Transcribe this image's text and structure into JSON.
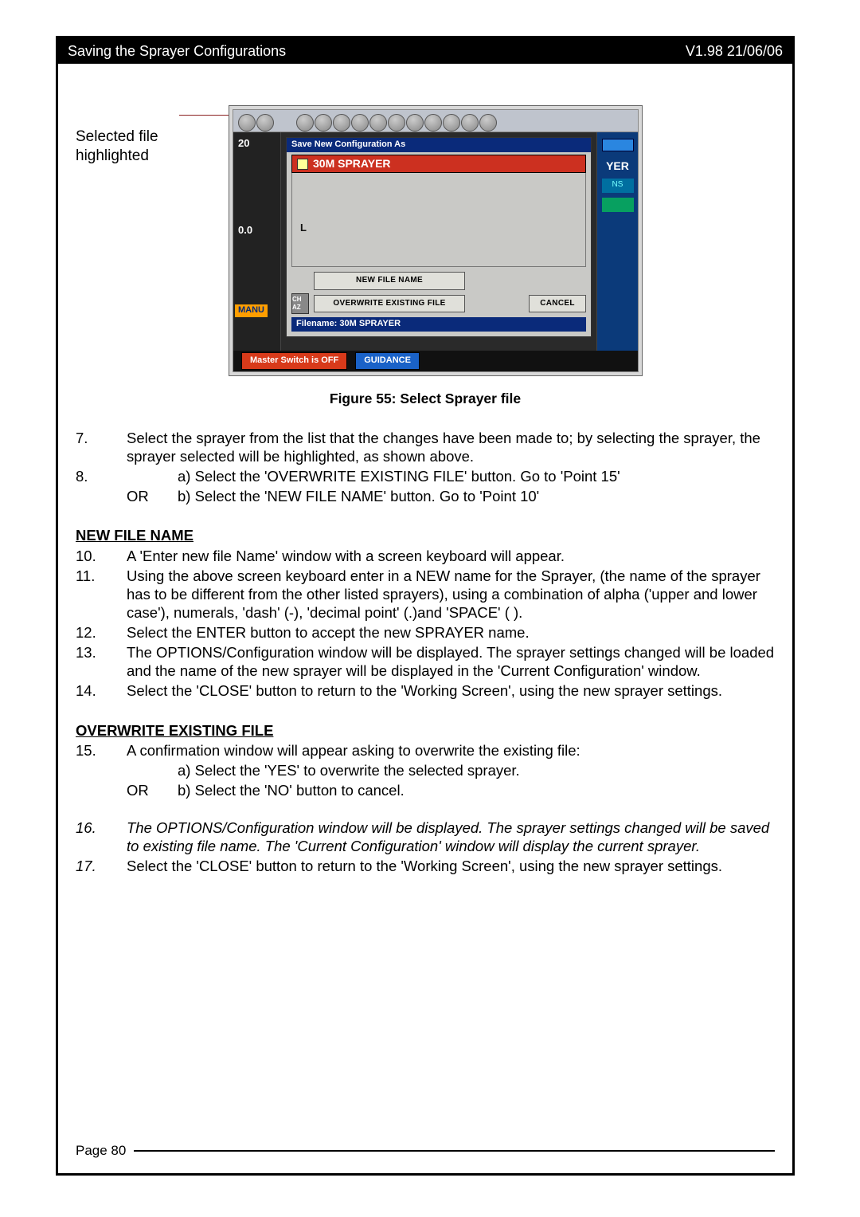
{
  "header": {
    "title": "Saving the Sprayer Configurations",
    "version": "V1.98 21/06/06"
  },
  "callout": {
    "line1": "Selected file",
    "line2": "highlighted"
  },
  "screenshot": {
    "dialog_title": "Save New Configuration As",
    "selected_file": "30M SPRAYER",
    "list_label_L": "L",
    "btn_new_file": "NEW FILE NAME",
    "btn_overwrite": "OVERWRITE EXISTING FILE",
    "btn_cancel": "CANCEL",
    "side_icon_label": "CH AZ",
    "filename_bar": "Filename: 30M SPRAYER",
    "footer_master": "Master Switch is OFF",
    "footer_guidance": "GUIDANCE",
    "footer_right": "",
    "left_val_top": "20",
    "left_val_bot": "0.0",
    "left_tag": "MANU",
    "right_text": "YER",
    "right_ns": "NS"
  },
  "figure_caption": "Figure 55:  Select Sprayer file",
  "steps_a": [
    {
      "num": "7.",
      "text": "Select the sprayer from the list that the changes have been made to; by selecting the sprayer, the sprayer selected will be highlighted, as shown above."
    },
    {
      "num": "8.",
      "text": "a) Select the 'OVERWRITE EXISTING FILE' button. Go to 'Point 15'"
    }
  ],
  "step8_or": {
    "or": "OR",
    "text": "b) Select the 'NEW FILE NAME' button. Go to 'Point 10'"
  },
  "section_new": "NEW FILE NAME",
  "steps_new": [
    {
      "num": "10.",
      "text": "A 'Enter new file Name' window with a screen keyboard will appear."
    },
    {
      "num": "11.",
      "text": "Using the above screen keyboard enter in a NEW name for the Sprayer, (the name of the sprayer has to be different from the other listed sprayers), using a combination of alpha ('upper and lower case'), numerals, 'dash' (-), 'decimal point' (.)and 'SPACE' ( )."
    },
    {
      "num": "12.",
      "text": "Select the ENTER button to accept the new SPRAYER name."
    },
    {
      "num": "13.",
      "text": "The OPTIONS/Configuration window will be displayed. The sprayer settings changed will be loaded and the name of the new sprayer will be displayed in the 'Current Configuration' window."
    },
    {
      "num": "14.",
      "text": "Select the 'CLOSE' button to return to the 'Working Screen', using the new sprayer settings."
    }
  ],
  "section_over": "OVERWRITE EXISTING FILE",
  "step15": {
    "num": "15.",
    "text": "A confirmation window will appear asking to overwrite the existing file:"
  },
  "step15a": "a) Select the 'YES' to overwrite the selected sprayer.",
  "step15b": {
    "or": "OR",
    "text": "b) Select the 'NO' button to cancel."
  },
  "step16": {
    "num": "16.",
    "text": "The OPTIONS/Configuration window will be displayed. The sprayer settings changed will be saved to existing file name. The 'Current Configuration' window will display the current sprayer."
  },
  "step17": {
    "num": "17.",
    "text": "Select the 'CLOSE' button to return to the 'Working Screen', using the new sprayer settings."
  },
  "footer": {
    "page": "Page  80"
  }
}
